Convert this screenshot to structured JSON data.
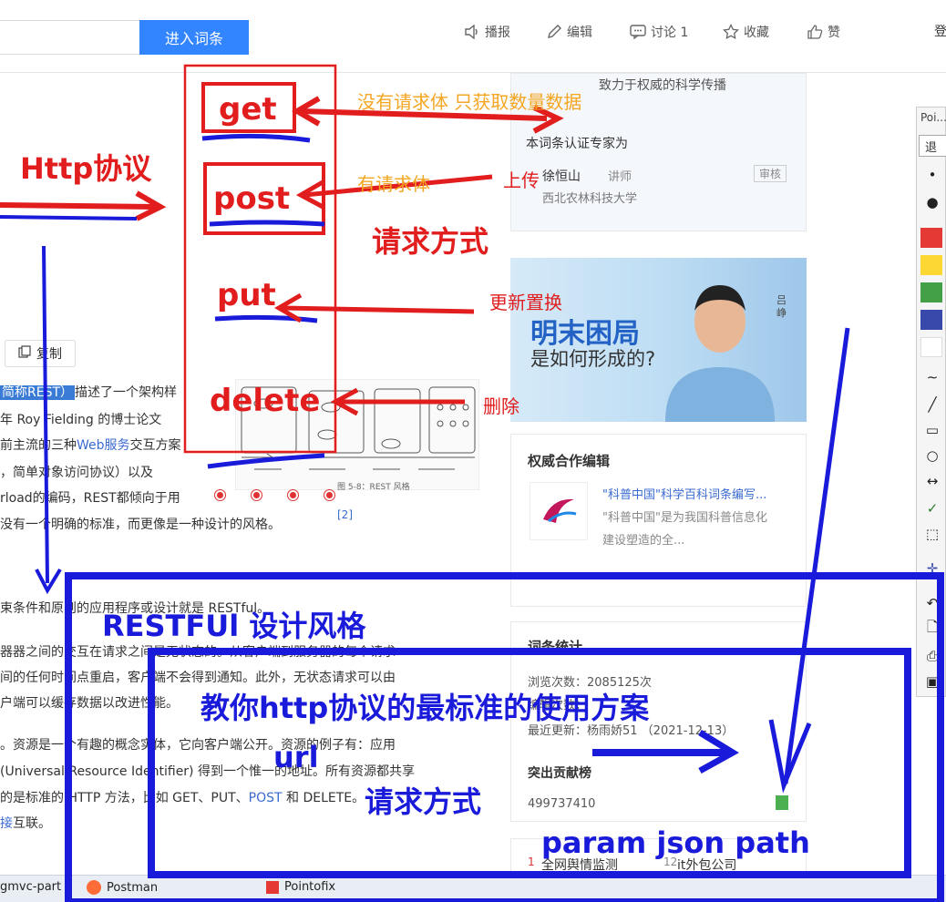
{
  "topbar": {
    "search_placeholder": "",
    "search_button": "进入词条",
    "actions": {
      "broadcast": "播报",
      "edit": "编辑",
      "discuss": "讨论 1",
      "collect": "收藏",
      "like": "赞"
    },
    "login": "登"
  },
  "article": {
    "copy_button": "复制",
    "lines": [
      {
        "pre": "",
        "hl": "简称REST）",
        "post": "描述了一个架构样"
      },
      {
        "text": "年 Roy Fielding 的博士论文"
      },
      {
        "pre": "前主流的三种",
        "link": "Web服务",
        "post": "交互方案"
      },
      {
        "text": "，简单对象访问协议）以及"
      },
      {
        "text": "rload的编码，REST都倾向于用"
      },
      {
        "text": "没有一个明确的标准，而更像是一种设计的风格。"
      },
      {
        "text": "束条件和原则的应用程序或设计就是 RESTful。"
      },
      {
        "text": "器器之间的交互在请求之间是无状态的。从客户端到服务器的每个请求"
      },
      {
        "text": "间的任何时间点重启，客户端不会得到通知。此外，无状态请求可以由"
      },
      {
        "text": "户端可以缓存数据以改进性能。"
      },
      {
        "text": "。资源是一个有趣的概念实体，它向客户端公开。资源的例子有：应用"
      },
      {
        "text": "(Universal Resource Identifier) 得到一个惟一的地址。所有资源都共享"
      },
      {
        "pre": "的是标准的 HTTP 方法，比如 GET、PUT、",
        "link": "POST",
        "post": " 和 DELETE。"
      },
      {
        "pre": "",
        "link": "接",
        "post": "互联。"
      }
    ],
    "ref": "[2]",
    "figure_caption": "图 5-8：REST 风格"
  },
  "sidebar": {
    "tagline": "致力于权威的科学传播",
    "expert_title": "本词条认证专家为",
    "expert_name": "徐恒山",
    "expert_role": "讲师",
    "expert_review": "审核",
    "expert_org": "西北农林科技大学",
    "banner_h1": "明末困局",
    "banner_h2": "是如何形成的?",
    "banner_author": "吕峥",
    "editors_title": "权威合作编辑",
    "editor_name": "\"科普中国\"科学百科词条编写...",
    "editor_desc1": "\"科普中国\"是为我国科普信息化",
    "editor_desc2": "建设塑造的全...",
    "stats_title": "词条统计",
    "stat_views": "浏览次数：2085125次",
    "stat_edits": "编辑次数：",
    "stat_updated": "最近更新：杨雨娇51 （2021-12-13）",
    "contrib_title": "突出贡献榜",
    "contrib_user": "499737410",
    "rank1_num": "1",
    "rank1": "全网舆情监测",
    "rank2_num": "12",
    "rank2": "it外包公司"
  },
  "tool_panel": {
    "title": "Poi...",
    "exit": "退",
    "colors": [
      "#e53935",
      "#fdd835",
      "#43a047",
      "#3949ab",
      "#ffffff"
    ]
  },
  "taskbar": {
    "items": [
      "gmvc-part",
      "Postman",
      "Pointofix"
    ]
  },
  "annotations": {
    "http": "Http协议",
    "get": "get",
    "post": "post",
    "put": "put",
    "delete": "delete",
    "get_note": "没有请求体 只获取数量数据",
    "post_note": "有请求体",
    "upload": "上传",
    "method_title": "请求方式",
    "update_note": "更新置换",
    "delete_note": "删除",
    "restful": "RESTFUl 设计风格",
    "teach": "教你http协议的最标准的使用方案",
    "url": "url",
    "method_title2": "请求方式",
    "params": "param json path",
    "colors": {
      "red": "#e11d1d",
      "blue": "#1a1adb",
      "orange": "#f5a623"
    }
  }
}
